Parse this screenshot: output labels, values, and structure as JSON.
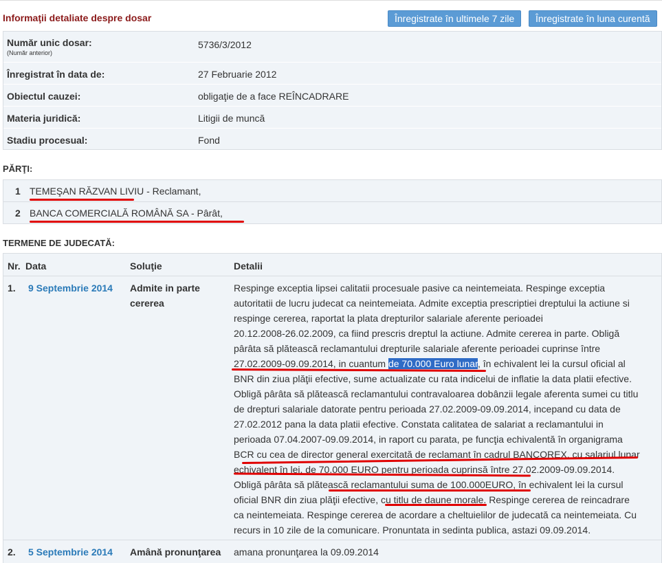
{
  "header": {
    "title": "Informaţii detaliate despre dosar",
    "btn_7_days": "Înregistrate în ultimele 7 zile",
    "btn_month": "Înregistrate în luna curentă"
  },
  "details": {
    "numar_label": "Număr unic dosar:",
    "numar_sub": "(Număr anterior)",
    "numar_value": "5736/3/2012",
    "inregistrat_label": "Înregistrat în data de:",
    "inregistrat_value": "27 Februarie 2012",
    "obiect_label": "Obiectul cauzei:",
    "obiect_value": "obligaţie de a face REÎNCADRARE",
    "materia_label": "Materia juridică:",
    "materia_value": "Litigii de muncă",
    "stadiu_label": "Stadiu procesual:",
    "stadiu_value": "Fond"
  },
  "parties": {
    "title": "PĂRŢI:",
    "items": [
      {
        "nr": "1",
        "name": "TEMEŞAN RĂZVAN LIVIU - Reclamant,"
      },
      {
        "nr": "2",
        "name": "BANCA COMERCIALĂ ROMÂNĂ SA - Pârât,"
      }
    ]
  },
  "terms": {
    "title": "TERMENE DE JUDECATĂ:",
    "headers": {
      "nr": "Nr.",
      "data": "Data",
      "solutie": "Soluţie",
      "detalii": "Detalii"
    },
    "rows": [
      {
        "nr": "1.",
        "data": "9 Septembrie 2014",
        "solutie_line1": "Admite in parte",
        "solutie_line2": "cererea",
        "detalii": [
          "Respinge exceptia lipsei calitatii procesuale pasive ca neintemeiata. Respinge exceptia",
          "autoritatii de lucru judecat ca neintemeiata. Admite exceptia prescriptiei dreptului la actiune si",
          "respinge cererea, raportat la plata drepturilor salariale aferente perioadei",
          "20.12.2008-26.02.2009, ca fiind prescris dreptul la actiune. Admite cererea in parte. Obligă",
          "pârâta să plătească reclamantului drepturile salariale aferente perioadei cuprinse între",
          "",
          "BNR din ziua plăţii efective, sume actualizate cu rata indicelui de inflatie la data platii efective.",
          "Obligă pârâta să plătească reclamantului contravaloarea dobânzii legale aferenta sumei cu titlu",
          "de drepturi salariale datorate pentru perioada 27.02.2009-09.09.2014, incepand cu data de",
          "27.02.2012 pana la data platii efective. Constata calitatea de salariat a reclamantului in",
          "perioada 07.04.2007-09.09.2014, in raport cu parata, pe funcţia echivalentă în organigrama",
          "BCR cu cea de director general exercitată de reclamant în cadrul BANCOREX, cu salariul lunar",
          "echivalent în lei, de 70.000 EURO pentru perioada cuprinsă între 27.02.2009-09.09.2014.",
          "Obligă pârâta să plătească reclamantului suma de 100.000EURO, în echivalent lei la cursul",
          "oficial BNR din ziua plăţii efective, cu titlu de daune morale. Respinge cererea de reincadrare",
          "ca neintemeiata. Respinge cererea de acordare a cheltuielilor de judecată ca neintemeiata. Cu",
          "recurs in 10 zile de la comunicare. Pronuntata in sedinta publica, astazi 09.09.2014."
        ],
        "line6_before": "27.02.2009-09.09.2014, in cuantum ",
        "line6_highlight": "de 70.000 Euro lunar",
        "line6_after": ", în echivalent lei la cursul oficial al"
      },
      {
        "nr": "2.",
        "data": "5 Septembrie 2014",
        "solutie": "Amână pronunţarea",
        "detalii": "amana pronunţarea la 09.09.2014"
      }
    ]
  },
  "colors": {
    "title": "#8b1a1a",
    "button": "#5b9bd5",
    "link": "#2a7ab8",
    "highlight": "#2e6bc6",
    "underline": "#e00000",
    "panel": "#f0f4f8"
  }
}
